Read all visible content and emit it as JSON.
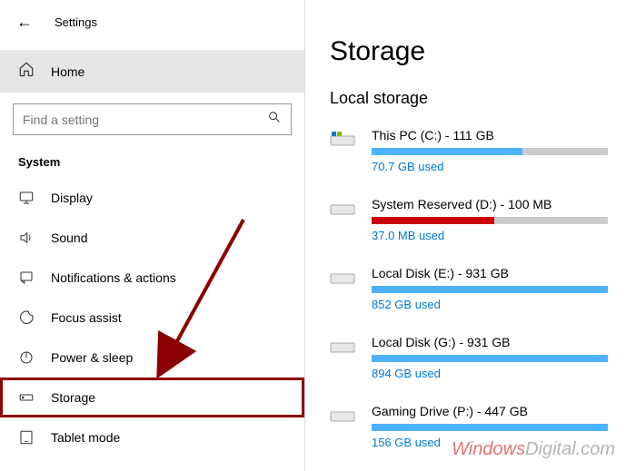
{
  "titlebar": {
    "title": "Settings"
  },
  "home": {
    "label": "Home"
  },
  "search": {
    "placeholder": "Find a setting"
  },
  "section": {
    "heading": "System"
  },
  "nav": {
    "display": "Display",
    "sound": "Sound",
    "notifications": "Notifications & actions",
    "focus": "Focus assist",
    "power": "Power & sleep",
    "storage": "Storage",
    "tablet": "Tablet mode"
  },
  "main": {
    "heading": "Storage",
    "subheading": "Local storage"
  },
  "drives": {
    "c": {
      "name": "This PC (C:) - 111 GB",
      "used": "70.7 GB used",
      "pct": 64,
      "color": "#4db2ff"
    },
    "d": {
      "name": "System Reserved (D:) - 100 MB",
      "used": "37.0 MB used",
      "pct": 52,
      "color": "#cc0000"
    },
    "e": {
      "name": "Local Disk (E:) - 931 GB",
      "used": "852 GB used",
      "pct": 100,
      "color": "#4db2ff"
    },
    "g": {
      "name": "Local Disk (G:) - 931 GB",
      "used": "894 GB used",
      "pct": 100,
      "color": "#4db2ff"
    },
    "p": {
      "name": "Gaming Drive (P:) - 447 GB",
      "used": "156 GB used",
      "pct": 100,
      "color": "#4db2ff"
    }
  },
  "watermark": {
    "part1": "Windows",
    "part2": "Digital.com"
  }
}
